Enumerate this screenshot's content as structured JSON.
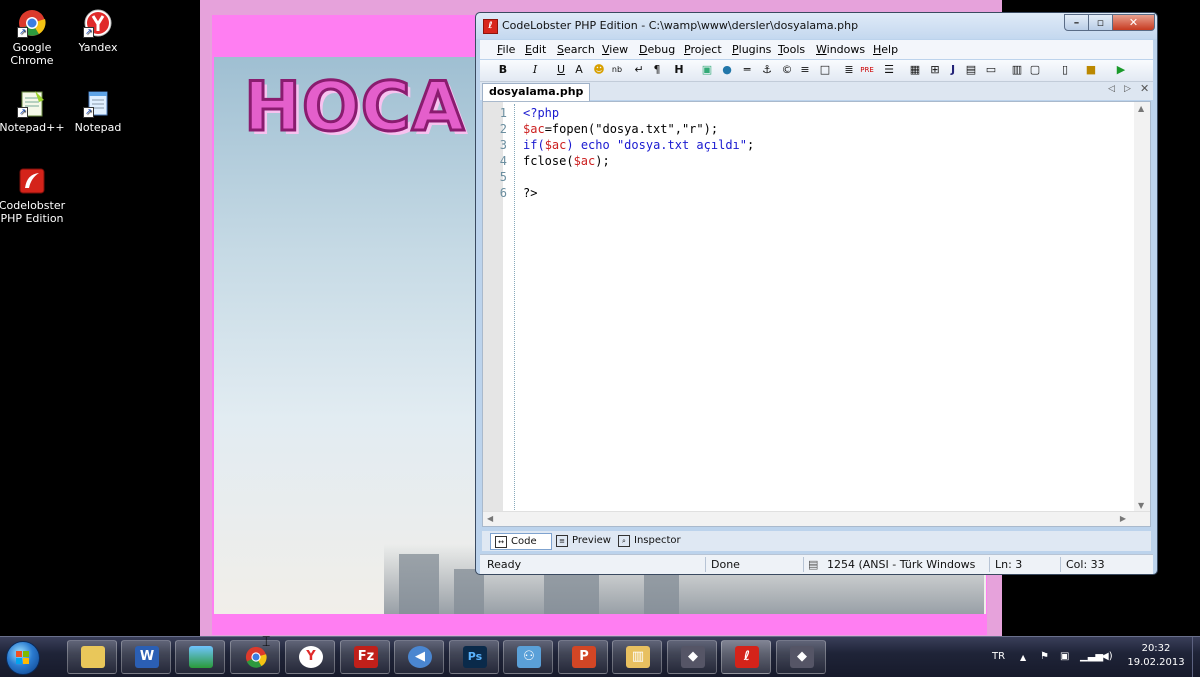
{
  "desktop": {
    "icons": [
      {
        "label": "Google\nChrome"
      },
      {
        "label": "Yandex"
      },
      {
        "label": "Notepad++"
      },
      {
        "label": "Notepad"
      },
      {
        "label": "Codelobster\nPHP Edition"
      }
    ]
  },
  "background_page": {
    "logo_text": "HOCA"
  },
  "window": {
    "title": "CodeLobster PHP Edition - C:\\wamp\\www\\dersler\\dosyalama.php",
    "menu": [
      "File",
      "Edit",
      "Search",
      "View",
      "Debug",
      "Project",
      "Plugins",
      "Tools",
      "Windows",
      "Help"
    ],
    "file_tab": "dosyalama.php",
    "line_numbers": [
      "1",
      "2",
      "3",
      "4",
      "5",
      "6"
    ],
    "code": {
      "l1_a": "<?php",
      "l2_var": "$ac",
      "l2_b": "=fopen(\"dosya.txt\",\"r\");",
      "l3_kw": "if(",
      "l3_var": "$ac",
      "l3_kw2": ") echo ",
      "l3_str": "\"dosya.txt açıldı\"",
      "l3_end": ";",
      "l4_a": "fclose(",
      "l4_var": "$ac",
      "l4_b": ");",
      "l6_a": "?>"
    },
    "view_tabs": [
      "Code",
      "Preview",
      "Inspector"
    ],
    "status": {
      "ready": "Ready",
      "done": "Done",
      "encoding": "1254 (ANSI - Türk Windows",
      "line": "Ln: 3",
      "col": "Col: 33"
    }
  },
  "taskbar": {
    "language": "TR",
    "time": "20:32",
    "date": "19.02.2013"
  },
  "colors": {
    "accent_pink": "#ff7ef2",
    "window_frame": "#bcd3ec",
    "keyword_blue": "#1a1ad0",
    "variable_red": "#cc2020"
  }
}
